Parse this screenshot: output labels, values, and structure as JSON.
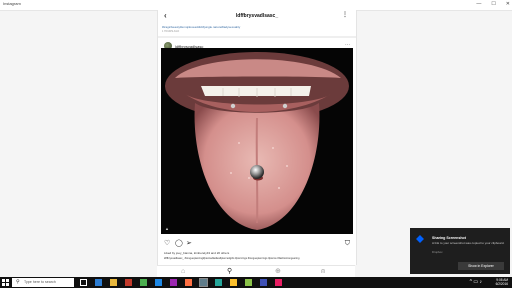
{
  "window": {
    "title": "Instagram",
    "controls": [
      "—",
      "☐",
      "✕"
    ]
  },
  "feed": {
    "profile_title": "ldffbrysvadlsasc_",
    "prev_caption_tags": "#tragicbeauty#emojiloveaddict#jungle.nature#ladysexuality",
    "prev_time": "1 HOURS AGO",
    "post": {
      "username": "ldffbrysvadlsasc_",
      "likes_text": "Liked by joey_bianna, kimberely43 and 20 others",
      "caption": "ldffbrysvadlsasc_ #tonguepiercing#piercedladies#piercedgirls #piercings #tonguepiercings #pierce #fashiontonguering"
    },
    "icons": {
      "back": "arrow-left-icon",
      "more": "ellipsis-icon",
      "like": "heart-icon",
      "comment": "comment-icon",
      "share": "send-icon",
      "save": "bookmark-icon"
    }
  },
  "bottom_nav": [
    "home-icon",
    "search-icon",
    "add-icon",
    "activity-icon",
    "profile-icon"
  ],
  "notification": {
    "title": "Sharing Screenshot",
    "body": "A link to your screenshot was copied to your clipboard.",
    "source": "Dropbox",
    "button": "Show in Explorer"
  },
  "taskbar": {
    "search_placeholder": "Type here to search",
    "time": "9:08 AM",
    "date": "6/2/2016"
  }
}
